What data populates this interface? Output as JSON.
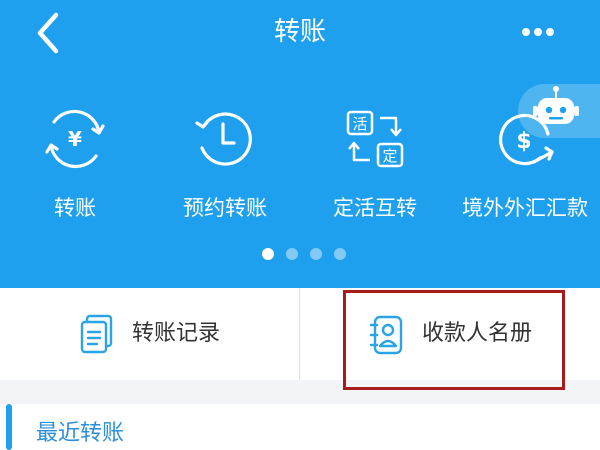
{
  "header": {
    "title": "转账",
    "back_icon": "chevron-left-icon",
    "more_icon": "more-dots-icon",
    "assistant_icon": "robot-icon",
    "background": "#1ea0ee"
  },
  "functions": [
    {
      "label": "转账",
      "icon": "yen-cycle-icon"
    },
    {
      "label": "预约转账",
      "icon": "clock-icon"
    },
    {
      "label": "定活互转",
      "icon": "fixed-current-swap-icon",
      "glyph_top": "活",
      "glyph_bottom": "定"
    },
    {
      "label": "境外外汇汇款",
      "icon": "dollar-transfer-icon"
    }
  ],
  "pager": {
    "count": 4,
    "active_index": 0
  },
  "actions": [
    {
      "label": "转账记录",
      "icon": "document-icon"
    },
    {
      "label": "收款人名册",
      "icon": "contact-book-icon",
      "highlighted": true
    }
  ],
  "recent": {
    "title": "最近转账"
  },
  "colors": {
    "accent": "#1ea0ee",
    "highlight_border": "#a91b1b",
    "section_title": "#2b8fd9"
  }
}
